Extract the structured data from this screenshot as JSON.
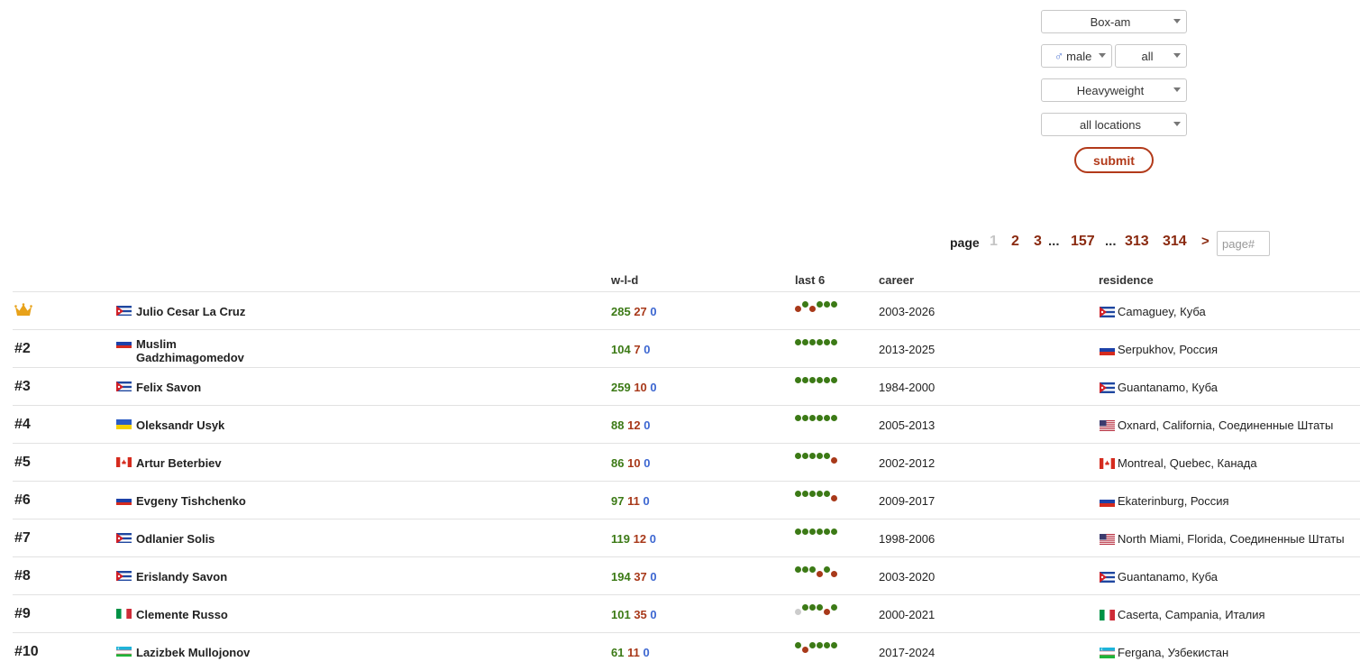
{
  "filters": {
    "sport": "Box-am",
    "gender": "male",
    "status": "all",
    "division": "Heavyweight",
    "location": "all locations",
    "submit_label": "submit"
  },
  "pagination": {
    "label": "page",
    "current": "1",
    "pages": [
      "2",
      "3"
    ],
    "ellipsis1": "...",
    "middle": "157",
    "ellipsis2": "...",
    "last_pages": [
      "313",
      "314"
    ],
    "next": ">",
    "input_placeholder": "page#"
  },
  "table": {
    "headers": {
      "wld": "w-l-d",
      "last6": "last 6",
      "career": "career",
      "residence": "residence"
    },
    "colors": {
      "win": "#3c7a16",
      "loss": "#a8391a",
      "draw": "#3d67d1",
      "na": "#cccccc"
    },
    "rows": [
      {
        "rank": "",
        "crown": true,
        "flag": "cu",
        "name": "Julio Cesar La Cruz",
        "w": "285",
        "l": "27",
        "d": "0",
        "last6": [
          "L",
          "W",
          "L",
          "W",
          "W",
          "W"
        ],
        "career": "2003-2026",
        "res_flag": "cu",
        "residence": "Camaguey, Куба"
      },
      {
        "rank": "#2",
        "flag": "ru",
        "name": "Muslim Gadzhimagomedov",
        "w": "104",
        "l": "7",
        "d": "0",
        "last6": [
          "W",
          "W",
          "W",
          "W",
          "W",
          "W"
        ],
        "career": "2013-2025",
        "res_flag": "ru",
        "residence": "Serpukhov, Россия"
      },
      {
        "rank": "#3",
        "flag": "cu",
        "name": "Felix Savon",
        "w": "259",
        "l": "10",
        "d": "0",
        "last6": [
          "W",
          "W",
          "W",
          "W",
          "W",
          "W"
        ],
        "career": "1984-2000",
        "res_flag": "cu",
        "residence": "Guantanamo, Куба"
      },
      {
        "rank": "#4",
        "flag": "ua",
        "name": "Oleksandr Usyk",
        "w": "88",
        "l": "12",
        "d": "0",
        "last6": [
          "W",
          "W",
          "W",
          "W",
          "W",
          "W"
        ],
        "career": "2005-2013",
        "res_flag": "us",
        "residence": "Oxnard, California, Соединенные Штаты"
      },
      {
        "rank": "#5",
        "flag": "ca",
        "name": "Artur Beterbiev",
        "w": "86",
        "l": "10",
        "d": "0",
        "last6": [
          "W",
          "W",
          "W",
          "W",
          "W",
          "L"
        ],
        "career": "2002-2012",
        "res_flag": "ca",
        "residence": "Montreal, Quebec, Канада"
      },
      {
        "rank": "#6",
        "flag": "ru",
        "name": "Evgeny Tishchenko",
        "w": "97",
        "l": "11",
        "d": "0",
        "last6": [
          "W",
          "W",
          "W",
          "W",
          "W",
          "L"
        ],
        "career": "2009-2017",
        "res_flag": "ru",
        "residence": "Ekaterinburg, Россия"
      },
      {
        "rank": "#7",
        "flag": "cu",
        "name": "Odlanier Solis",
        "w": "119",
        "l": "12",
        "d": "0",
        "last6": [
          "W",
          "W",
          "W",
          "W",
          "W",
          "W"
        ],
        "career": "1998-2006",
        "res_flag": "us",
        "residence": "North Miami, Florida, Соединенные Штаты"
      },
      {
        "rank": "#8",
        "flag": "cu",
        "name": "Erislandy Savon",
        "w": "194",
        "l": "37",
        "d": "0",
        "last6": [
          "W",
          "W",
          "W",
          "L",
          "W",
          "L"
        ],
        "career": "2003-2020",
        "res_flag": "cu",
        "residence": "Guantanamo, Куба"
      },
      {
        "rank": "#9",
        "flag": "it",
        "name": "Clemente Russo",
        "w": "101",
        "l": "35",
        "d": "0",
        "last6": [
          "N",
          "W",
          "W",
          "W",
          "L",
          "W"
        ],
        "career": "2000-2021",
        "res_flag": "it",
        "residence": "Caserta, Campania, Италия"
      },
      {
        "rank": "#10",
        "flag": "uz",
        "name": "Lazizbek Mullojonov",
        "w": "61",
        "l": "11",
        "d": "0",
        "last6": [
          "W",
          "L",
          "W",
          "W",
          "W",
          "W"
        ],
        "career": "2017-2024",
        "res_flag": "uz",
        "residence": "Fergana, Узбекистан"
      }
    ]
  }
}
